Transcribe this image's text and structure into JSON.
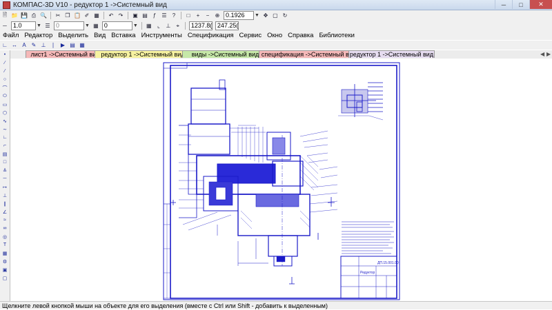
{
  "window": {
    "title": "КОМПАС-3D V10 - редуктор 1 ->Системный вид"
  },
  "toolbar": {
    "zoom_value": "0.1926",
    "line_width": "1.0",
    "layer_value": "0",
    "style_value": "0",
    "coord_x": "1237.8(",
    "coord_y": "247.25("
  },
  "menu": [
    "Файл",
    "Редактор",
    "Выделить",
    "Вид",
    "Вставка",
    "Инструменты",
    "Спецификация",
    "Сервис",
    "Окно",
    "Справка",
    "Библиотеки"
  ],
  "tabs": [
    {
      "label": "лист1 ->Системный вид",
      "color": "#f5b8b8"
    },
    {
      "label": "редуктор 1 ->Системный вид",
      "color": "#f7f2a0"
    },
    {
      "label": "виды ->Системный вид",
      "color": "#c6e8a8"
    },
    {
      "label": "спецификация ->Системный вид",
      "color": "#f5b8b8"
    },
    {
      "label": "редуктор 1 ->Системный вид",
      "color": "#e6dcf0"
    }
  ],
  "status": {
    "text": "Щелкните левой кнопкой мыши на объекте для его выделения (вместе с Ctrl или Shift - добавить к выделенным)"
  },
  "drawing": {
    "accent": "#1a1ac8"
  }
}
